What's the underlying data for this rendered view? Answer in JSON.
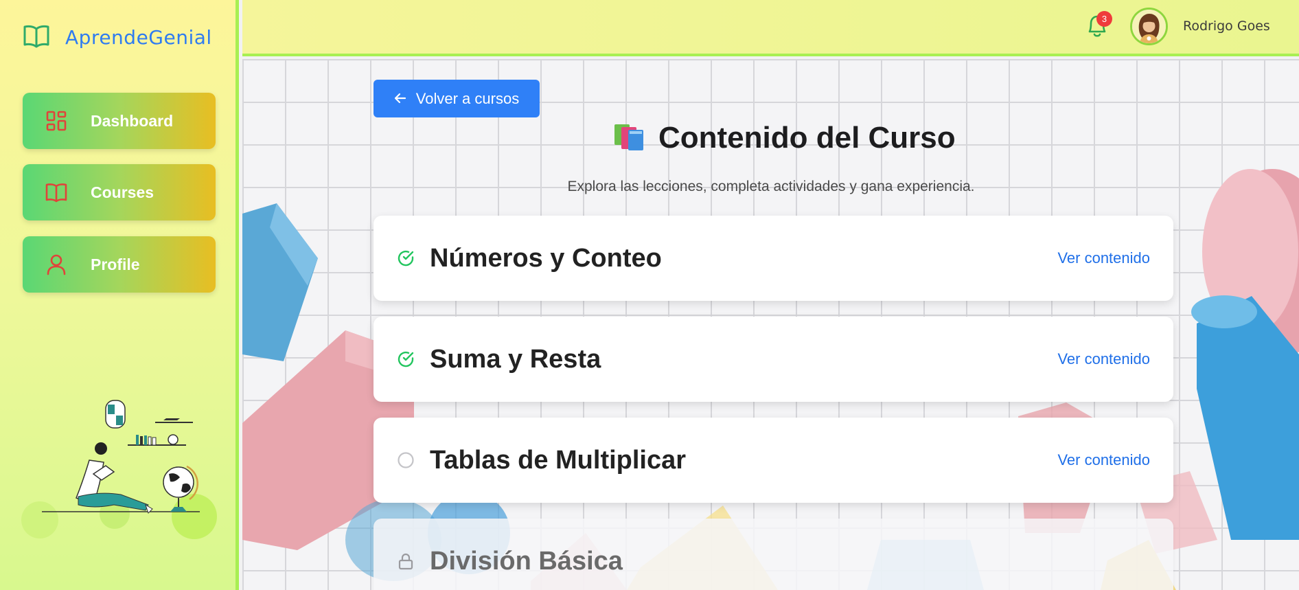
{
  "app": {
    "name": "AprendeGenial"
  },
  "sidebar": {
    "items": [
      {
        "label": "Dashboard",
        "icon": "dashboard-grid-icon"
      },
      {
        "label": "Courses",
        "icon": "book-icon"
      },
      {
        "label": "Profile",
        "icon": "user-icon"
      }
    ]
  },
  "header": {
    "notifications_count": "3",
    "user_name": "Rodrigo Goes"
  },
  "main": {
    "back_label": "Volver a cursos",
    "title": "Contenido del Curso",
    "subtitle": "Explora las lecciones, completa actividades y gana experiencia.",
    "lessons": [
      {
        "name": "Números y Conteo",
        "status": "completed",
        "link": "Ver contenido"
      },
      {
        "name": "Suma y Resta",
        "status": "completed",
        "link": "Ver contenido"
      },
      {
        "name": "Tablas de Multiplicar",
        "status": "pending",
        "link": "Ver contenido"
      },
      {
        "name": "División Básica",
        "status": "locked",
        "link": ""
      }
    ]
  },
  "colors": {
    "accent": "#2f80f7",
    "nav_gradient_start": "#5ad774",
    "nav_gradient_end": "#e8be22",
    "completed_green": "#22c55e",
    "link_blue": "#1f6fe8",
    "badge_red": "#ef3b3b"
  }
}
